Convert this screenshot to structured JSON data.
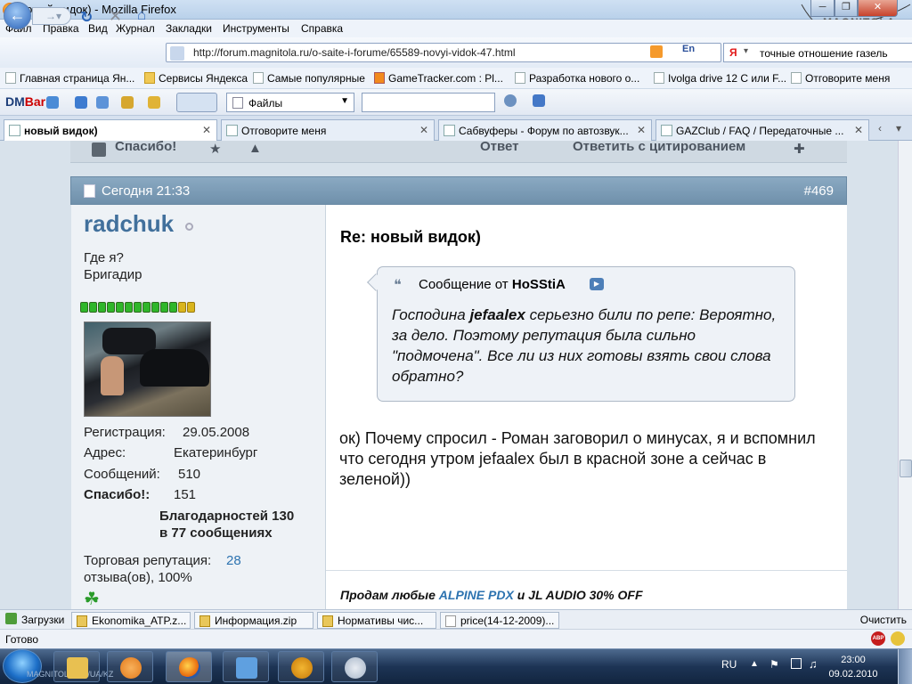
{
  "window": {
    "title": "новый видок) - Mozilla Firefox",
    "close_label": "✕",
    "min_label": "─",
    "max_label": "❐",
    "watermark": "MAGNITOLA"
  },
  "menu": [
    "Файл",
    "Правка",
    "Вид",
    "Журнал",
    "Закладки",
    "Инструменты",
    "Справка"
  ],
  "nav": {
    "url": "http://forum.magnitola.ru/o-saite-i-forume/65589-novyi-vidok-47.html",
    "search_engine": "Я",
    "search_value": "точные отношение газель",
    "translate_label": "En"
  },
  "bookmarks": [
    {
      "label": "Главная страница Ян..."
    },
    {
      "label": "Сервисы Яндекса"
    },
    {
      "label": "Самые популярные"
    },
    {
      "label": "GameTracker.com : Pl..."
    },
    {
      "label": "Разработка нового о..."
    },
    {
      "label": "Ivolga drive 12 С или F..."
    },
    {
      "label": "Отговорите меня"
    }
  ],
  "dmbar": {
    "logo_a": "DM",
    "logo_b": "Bar",
    "files_label": "Файлы"
  },
  "tabs": [
    {
      "label": "новый видок)",
      "close": "✕"
    },
    {
      "label": "Отговорите меня",
      "close": "✕"
    },
    {
      "label": "Сабвуферы - Форум по автозвук...",
      "close": "✕"
    },
    {
      "label": "GAZClub / FAQ / Передаточные ...",
      "close": "✕"
    }
  ],
  "post_actions": {
    "thanks": "Спасибо!",
    "reply": "Ответ",
    "reply_quote": "Ответить с цитированием"
  },
  "post": {
    "date": "Сегодня 21:33",
    "number": "#469",
    "user": {
      "name": "radchuk",
      "location_label": "Где я?",
      "rank": "Бригадир",
      "rep_green": 11,
      "rep_yellow": 2,
      "reg_label": "Регистрация:",
      "reg_value": "29.05.2008",
      "addr_label": "Адрес:",
      "addr_value": "Екатеринбург",
      "msgs_label": "Сообщений:",
      "msgs_value": "510",
      "thanks_label": "Спасибо!:",
      "thanks_value": "151",
      "thanked_1": "Благодарностей 130",
      "thanked_2": "в 77 сообщениях",
      "trade_label": "Торговая репутация:",
      "trade_value": "28",
      "trade_suffix": "отзыва(ов), 100%"
    },
    "title": "Re: новый видок)",
    "quote": {
      "header_prefix": "Сообщение от",
      "author": "HoSStiA",
      "line_pre": "Господина ",
      "line_bold": "jefaalex",
      "text": " серьезно били по репе: Вероятно, за дело. Поэтому репутация была сильно \"подмочена\". Все ли из них готовы взять свои слова обратно?"
    },
    "body": "ок) Почему спросил - Роман заговорил о минусах, я и вспомнил что сегодня утром jefaalex был в красной зоне а сейчас в зеленой))",
    "signature": {
      "p1": "Продам любые ",
      "a1": "ALPINE PDX",
      "p2": " и ",
      "p3": "JL AUDIO 30% OFF"
    }
  },
  "downloads": {
    "label": "Загрузки",
    "items": [
      "Ekonomika_ATP.z...",
      "Информация.zip",
      "Нормативы чис...",
      "price(14-12-2009)..."
    ],
    "clear": "Очистить"
  },
  "status": {
    "text": "Готово",
    "abp": "ABP"
  },
  "taskbar": {
    "lang": "RU",
    "time": "23:00",
    "date": "09.02.2010",
    "start_caption": "MAGNITOLA.RU/UA/KZ"
  },
  "colors": {
    "accent": "#41709c",
    "post_header": "#7c9bb5",
    "link": "#2d73b0"
  }
}
